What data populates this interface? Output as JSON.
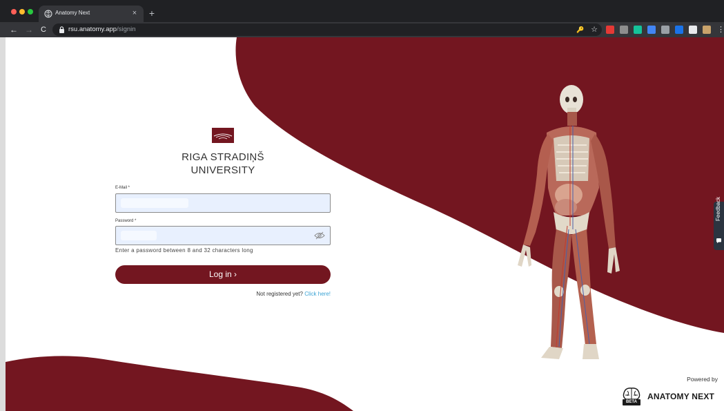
{
  "browser": {
    "tab": {
      "title": "Anatomy Next",
      "close": "×"
    },
    "new_tab": "+",
    "nav": {
      "back": "←",
      "forward": "→",
      "reload": "C"
    },
    "url": {
      "host": "rsu.anatomy.app",
      "path": "/signin"
    },
    "key_icon": "🔑",
    "star_icon": "☆",
    "menu_icon": "⋮",
    "extensions": [
      {
        "name": "adblock-icon",
        "color": "#e53935"
      },
      {
        "name": "facebook-container-icon",
        "color": "#8e8e8e"
      },
      {
        "name": "grammarly-icon",
        "color": "#15c39a"
      },
      {
        "name": "extension-blue-icon",
        "color": "#4285f4"
      },
      {
        "name": "search-extension-icon",
        "color": "#9aa0a6"
      },
      {
        "name": "password-extension-icon",
        "color": "#1a73e8"
      },
      {
        "name": "puzzle-icon",
        "color": "#e8eaed"
      },
      {
        "name": "profile-avatar-icon",
        "color": "#c9a36b"
      }
    ]
  },
  "brand_colors": {
    "primary": "#731620",
    "link": "#3aa3d4",
    "input_fill": "#e8f0fe"
  },
  "university": {
    "line1": "RIGA STRADIŅŠ",
    "line2": "UNIVERSITY"
  },
  "form": {
    "email_label": "E-Mail *",
    "email_value": "",
    "password_label": "Password *",
    "password_value": "",
    "password_hint": "Enter a password between 8 and 32 characters long",
    "login_label": "Log in  ›",
    "register_text": "Not registered yet? ",
    "register_link": "Click here!"
  },
  "feedback": {
    "label": "Feedback"
  },
  "footer": {
    "powered_by": "Powered by",
    "brand_name": "ANATOMY NEXT",
    "badge": "BETA"
  }
}
